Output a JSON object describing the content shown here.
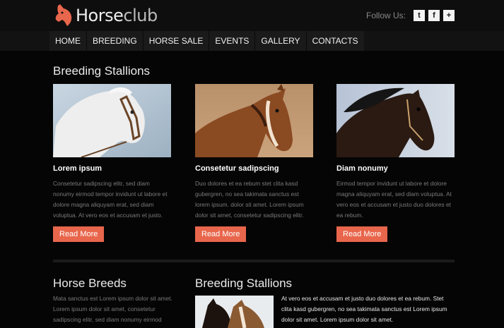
{
  "header": {
    "logo_main": "Horse",
    "logo_accent": "club",
    "follow_label": "Follow Us:",
    "social": [
      {
        "icon": "twitter-icon",
        "glyph": "t"
      },
      {
        "icon": "facebook-icon",
        "glyph": "f"
      },
      {
        "icon": "plus-icon",
        "glyph": "+"
      }
    ]
  },
  "nav": [
    "HOME",
    "BREEDING",
    "HORSE SALE",
    "EVENTS",
    "GALLERY",
    "CONTACTS"
  ],
  "main": {
    "title": "Breeding Stallions",
    "cards": [
      {
        "name": "Lorem ipsum",
        "desc": "Consetetur sadipscing elitr, sed diam nonumy eirmod tempor invidunt ut labore et dolore magna aliquyam erat, sed diam voluptua. At vero eos et accusam et justo.",
        "button": "Read More"
      },
      {
        "name": "Consetetur sadipscing",
        "desc": "Duo dolores et ea rebum stet clita kasd gubergren, no sea takimata sanctus est lorem ipsum. dolor sit amet. Lorem ipsum dolor sit amet, consetetur sadipscing elitr.",
        "button": "Read More"
      },
      {
        "name": "Diam nonumy",
        "desc": "Eirmod tempor invidunt ut labore et dolore magna aliquyam erat, sed diam voluptua. At vero eos et accusam et justo duo dolores et ea rebum.",
        "button": "Read More"
      }
    ]
  },
  "bottom": {
    "breeds_title": "Horse Breeds",
    "breeds_text": "Mata sanctus est Lorem ipsum dolor sit amet. Lorem ipsum dolor sit amet, consetetur sadipscing elitr, sed diam nonumy eirmod tempor invidunt ut labore et dolore",
    "stallions_title": "Breeding Stallions",
    "stallions_text": "At vero eos et accusam et justo duo dolores et ea rebum. Stet clita kasd gubergren, no sea takimata sanctus est Lorem ipsum dolor sit amet. Lorem ipsum dolor sit amet."
  },
  "colors": {
    "accent": "#e8664c",
    "background": "#050505"
  }
}
